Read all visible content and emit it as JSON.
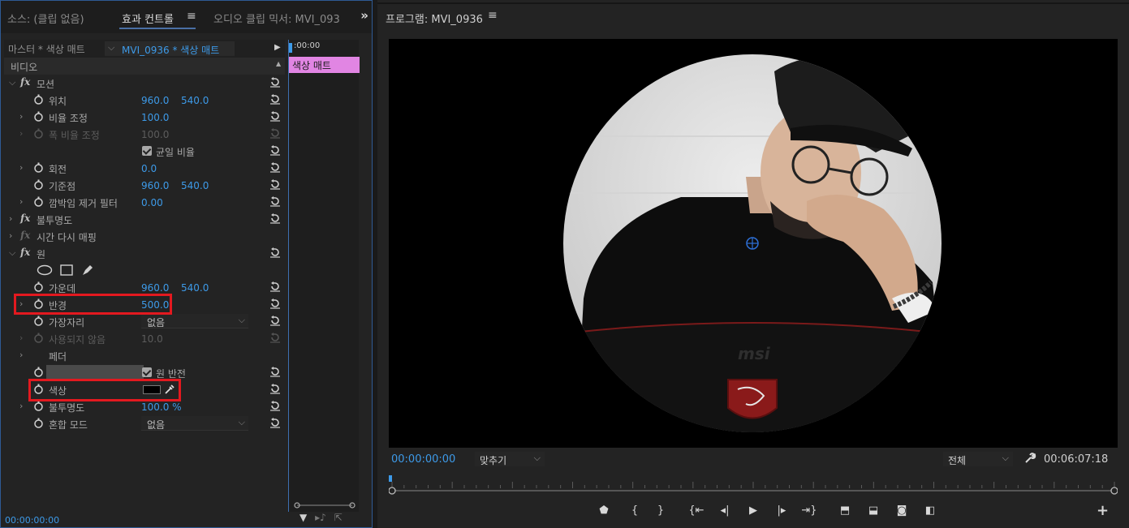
{
  "left_panel": {
    "tabs": {
      "source": "소스: (클립 없음)",
      "effect_controls": "효과 컨트롤",
      "audio_mixer": "오디오 클립 믹서: MVI_093"
    },
    "master_label": "마스터 * 색상 매트",
    "clip_selector": "MVI_0936 * 색상 매트",
    "timeline": {
      "time": ":00:00",
      "clip_label": "색상 매트"
    },
    "video_header": "비디오",
    "rows": {
      "motion": "모션",
      "position": "위치",
      "position_x": "960.0",
      "position_y": "540.0",
      "scale": "비율 조정",
      "scale_value": "100.0",
      "scale_width": "폭 비율 조정",
      "scale_width_value": "100.0",
      "uniform_scale": "균일 비율",
      "rotation": "회전",
      "rotation_value": "0.0",
      "anchor": "기준점",
      "anchor_x": "960.0",
      "anchor_y": "540.0",
      "anti_flicker": "깜박임 제거 필터",
      "anti_flicker_value": "0.00",
      "opacity_fx": "불투명도",
      "time_remap": "시간 다시 매핑",
      "circle_fx": "원",
      "center": "가운데",
      "center_x": "960.0",
      "center_y": "540.0",
      "radius": "반경",
      "radius_value": "500.0",
      "edge": "가장자리",
      "edge_value": "없음",
      "unused": "사용되지 않음",
      "unused_value": "10.0",
      "feather": "페더",
      "invert_circle": "원 반전",
      "color": "색상",
      "opacity": "불투명도",
      "opacity_value": "100.0 %",
      "blend_mode": "혼합 모드",
      "blend_mode_value": "없음"
    },
    "footer_time": "00:00:00:00"
  },
  "program_monitor": {
    "title": "프로그램: MVI_0936",
    "timecode_current": "00:00:00:00",
    "fit_label": "맞추기",
    "quality_label": "전체",
    "timecode_duration": "00:06:07:18",
    "brand_text": "msi"
  },
  "colors": {
    "accent_blue": "#3d9ae8",
    "highlight_red": "#e3191f",
    "clip_pink": "#e185e3"
  }
}
